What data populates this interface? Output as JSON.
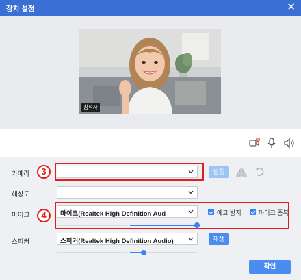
{
  "window": {
    "title": "장치 설정",
    "close_icon": "close-icon"
  },
  "preview": {
    "participant_tag": "참석자"
  },
  "toolbar": {
    "icons": [
      "camera-off-icon",
      "microphone-icon",
      "speaker-icon"
    ]
  },
  "camera": {
    "label": "카메라",
    "value": "",
    "settings_button": "설정",
    "marker": "3"
  },
  "resolution": {
    "label": "해상도",
    "value": ""
  },
  "mic": {
    "label": "마이크",
    "value": "마이크(Realtek High Definition Aud",
    "marker": "4",
    "echo_label": "에코 방지",
    "echo_checked": true,
    "dup_label": "마이크 중복",
    "dup_checked": true,
    "input_level": 0.0,
    "volume": 1.0
  },
  "speaker": {
    "label": "스피커",
    "value": "스피커(Realtek High Definition Audio)",
    "play_button": "재생",
    "volume": 0.2
  },
  "confirm_button": "확인",
  "colors": {
    "titlebar": "#3a6fd3",
    "accent": "#4a8cf0",
    "highlight": "#e02020"
  }
}
